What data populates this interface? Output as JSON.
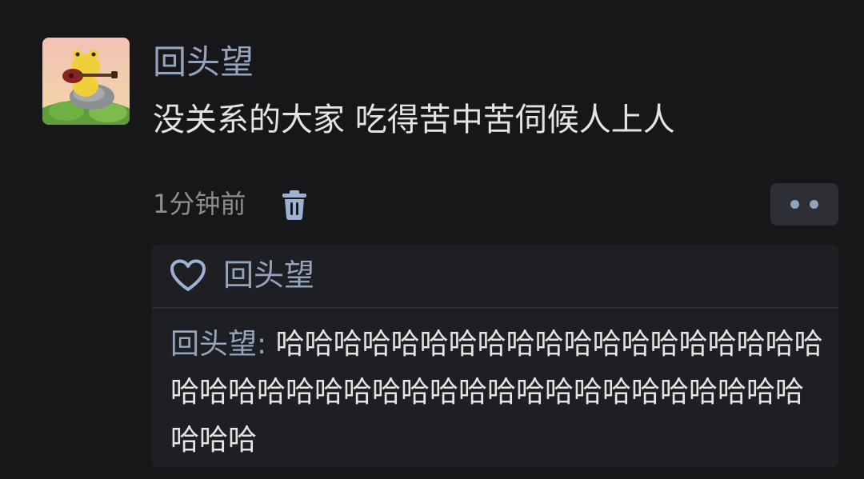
{
  "post": {
    "username": "回头望",
    "text": "没关系的大家 吃得苦中苦伺候人上人",
    "timestamp": "1分钟前"
  },
  "likes": {
    "liked_by": "回头望"
  },
  "comment": {
    "author": "回头望",
    "separator": ":",
    "text": " 哈哈哈哈哈哈哈哈哈哈哈哈哈哈哈哈哈哈哈哈哈哈哈哈哈哈哈哈哈哈哈哈哈哈哈哈哈哈哈哈哈哈哈哈"
  },
  "icons": {
    "delete": "trash-icon",
    "more": "more-dots-icon",
    "like": "heart-icon"
  },
  "colors": {
    "background": "#171719",
    "name": "#93a4bc",
    "text": "#e4e4e6",
    "muted": "#8d8d92",
    "panel": "#1e1f22",
    "button": "#2d2f34"
  }
}
